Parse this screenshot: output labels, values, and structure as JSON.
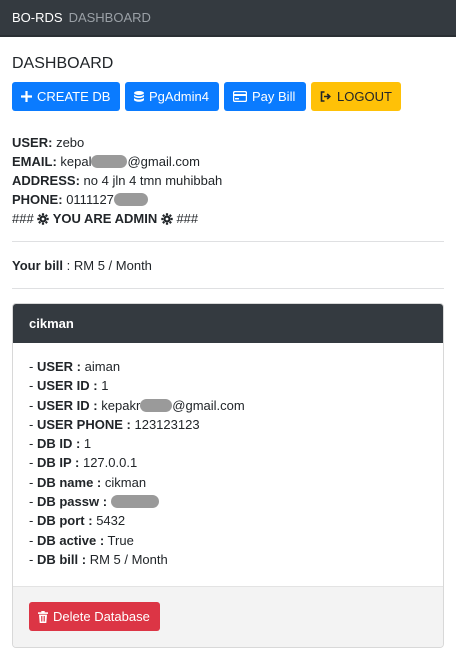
{
  "navbar": {
    "brand": "BO-RDS",
    "link": "DASHBOARD"
  },
  "page": {
    "title": "DASHBOARD"
  },
  "buttons": {
    "create_db": "CREATE DB",
    "pgadmin": "PgAdmin4",
    "pay_bill": "Pay Bill",
    "logout": "LOGOUT"
  },
  "user": {
    "user_label": "USER:",
    "user_value": "zebo",
    "email_label": "EMAIL:",
    "email_prefix": "kepal",
    "email_suffix": "@gmail.com",
    "address_label": "ADDRESS:",
    "address_value": "no 4 jln 4 tmn muhibbah",
    "phone_label": "PHONE:",
    "phone_prefix": "0111127",
    "admin_prefix": "###",
    "admin_text": "YOU ARE ADMIN",
    "admin_suffix": "###"
  },
  "bill": {
    "label": "Your bill",
    "value": " : RM 5 / Month"
  },
  "database_card": {
    "header": "cikman",
    "user_label": "USER :",
    "user_value": "aiman",
    "user_id_label": "USER ID :",
    "user_id_value": "1",
    "user_email_label": "USER ID :",
    "user_email_prefix": "kepakr",
    "user_email_suffix": "@gmail.com",
    "user_phone_label": "USER PHONE :",
    "user_phone_value": "123123123",
    "db_id_label": "DB ID :",
    "db_id_value": "1",
    "db_ip_label": "DB IP :",
    "db_ip_value": "127.0.0.1",
    "db_name_label": "DB name :",
    "db_name_value": "cikman",
    "db_passw_label": "DB passw :",
    "db_port_label": "DB port :",
    "db_port_value": "5432",
    "db_active_label": "DB active :",
    "db_active_value": "True",
    "db_bill_label": "DB bill :",
    "db_bill_value": "RM 5 / Month",
    "delete_button": "Delete Database"
  }
}
